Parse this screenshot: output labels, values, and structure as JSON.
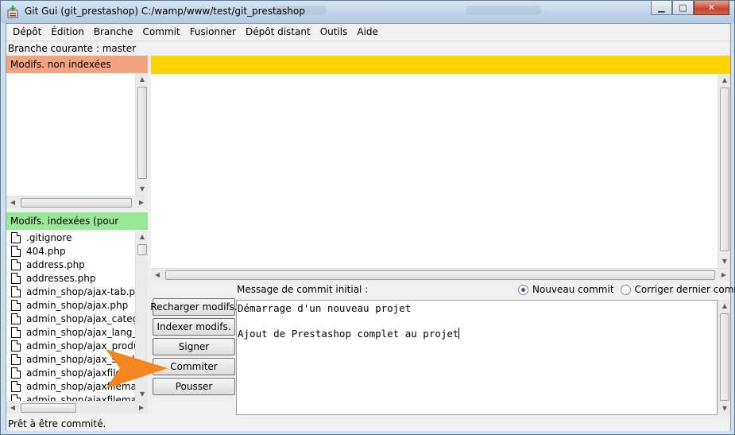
{
  "window": {
    "title": "Git Gui (git_prestashop) C:/wamp/www/test/git_prestashop",
    "controls": {
      "minimize": "▁",
      "maximize": "□",
      "close": "✕"
    }
  },
  "menu": [
    "Dépôt",
    "Édition",
    "Branche",
    "Commit",
    "Fusionner",
    "Dépôt distant",
    "Outils",
    "Aide"
  ],
  "branch_bar": "Branche courante : master",
  "unstaged": {
    "header": "Modifs. non indexées",
    "header_color": "#f4a382",
    "files": []
  },
  "staged": {
    "header": "Modifs. indexées (pour commit)",
    "header_color": "#98e898",
    "files": [
      ".gitignore",
      "404.php",
      "address.php",
      "addresses.php",
      "admin_shop/ajax-tab.php",
      "admin_shop/ajax.php",
      "admin_shop/ajax_categor",
      "admin_shop/ajax_lang_pa",
      "admin_shop/ajax_produc",
      "admin_shop/ajax_send",
      "admin_shop/ajaxfilem",
      "admin_shop/ajaxfilemana",
      "admin_shop/ajaxfilemana"
    ]
  },
  "diff": {
    "header_color": "#ffd200"
  },
  "commit": {
    "label": "Message de commit initial :",
    "radio_new": "Nouveau commit",
    "radio_amend": "Corriger dernier commit",
    "selected": "new",
    "message_line1": "Démarrage d'un nouveau projet",
    "message_line2": "",
    "message_line3": "Ajout de Prestashop complet au projet"
  },
  "buttons": {
    "rescan": "Recharger modifs.",
    "stage": "Indexer modifs.",
    "signoff": "Signer",
    "commit": "Commiter",
    "push": "Pousser"
  },
  "status": "Prêt à être commité.",
  "annotation": {
    "arrow_color": "#f5861f"
  },
  "scroll_arrows": {
    "up": "▲",
    "down": "▼",
    "left": "◀",
    "right": "▶"
  }
}
